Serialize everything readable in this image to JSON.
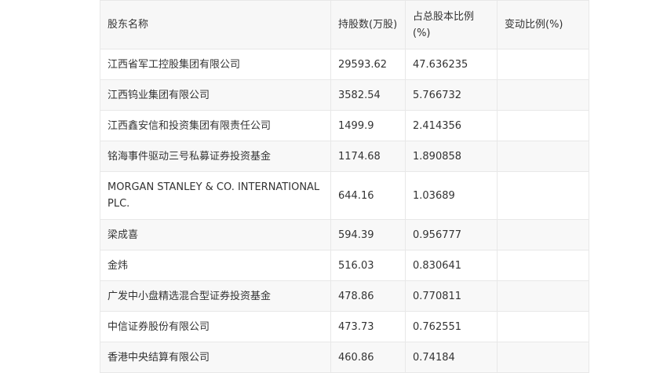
{
  "table": {
    "headers": [
      "股东名称",
      "持股数(万股)",
      "占总股本比例(%)",
      "变动比例(%)"
    ],
    "rows": [
      [
        "江西省军工控股集团有限公司",
        "29593.62",
        "47.636235",
        ""
      ],
      [
        "江西钨业集团有限公司",
        "3582.54",
        "5.766732",
        ""
      ],
      [
        "江西鑫安信和投资集团有限责任公司",
        "1499.9",
        "2.414356",
        ""
      ],
      [
        "铭海事件驱动三号私募证券投资基金",
        "1174.68",
        "1.890858",
        ""
      ],
      [
        "MORGAN STANLEY & CO. INTERNATIONAL PLC.",
        "644.16",
        "1.03689",
        ""
      ],
      [
        "梁成喜",
        "594.39",
        "0.956777",
        ""
      ],
      [
        "金炜",
        "516.03",
        "0.830641",
        ""
      ],
      [
        "广发中小盘精选混合型证券投资基金",
        "478.86",
        "0.770811",
        ""
      ],
      [
        "中信证券股份有限公司",
        "473.73",
        "0.762551",
        ""
      ],
      [
        "香港中央结算有限公司",
        "460.86",
        "0.74184",
        ""
      ]
    ]
  }
}
